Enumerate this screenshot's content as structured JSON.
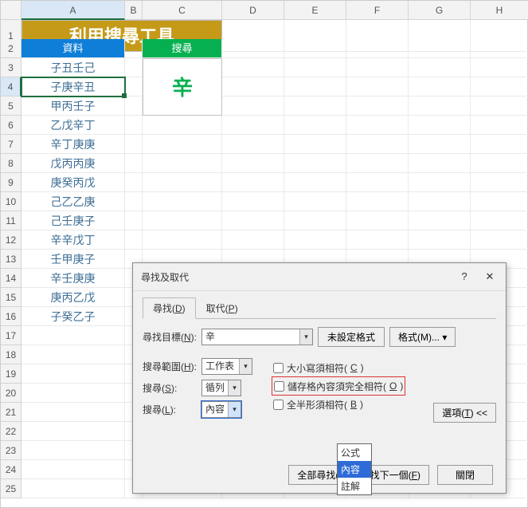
{
  "columns": [
    "A",
    "B",
    "C",
    "D",
    "E",
    "F",
    "G",
    "H"
  ],
  "title": "利用搜尋工具",
  "headers": {
    "data": "資料",
    "search": "搜尋"
  },
  "search_value": "辛",
  "data_values": [
    "子丑壬己",
    "子庚辛丑",
    "甲丙壬子",
    "乙戊辛丁",
    "辛丁庚庚",
    "戊丙丙庚",
    "庚癸丙戊",
    "己乙乙庚",
    "己壬庚子",
    "辛辛戊丁",
    "壬甲庚子",
    "辛壬庚庚",
    "庚丙乙戊",
    "子癸乙子"
  ],
  "selected_row": 4,
  "dialog": {
    "title": "尋找及取代",
    "tab_find": "尋找(D)",
    "tab_replace": "取代(P)",
    "find_label": "尋找目標(N):",
    "find_value": "辛",
    "no_format": "未設定格式",
    "format_btn": "格式(M)...",
    "scope_label": "搜尋範圍(H):",
    "scope_value": "工作表",
    "search_label": "搜尋(S):",
    "search_value": "循列",
    "lookin_label": "搜尋(L):",
    "lookin_value": "內容",
    "chk_case": "大小寫須相符(C)",
    "chk_whole": "儲存格內容須完全相符(O)",
    "chk_width": "全半形須相符(B)",
    "options_btn": "選項(T) <<",
    "dd_formula": "公式",
    "dd_value": "內容",
    "dd_comment": "註解",
    "btn_findall": "全部尋找(I)",
    "btn_findnext": "找下一個(F)",
    "btn_close": "關閉"
  }
}
